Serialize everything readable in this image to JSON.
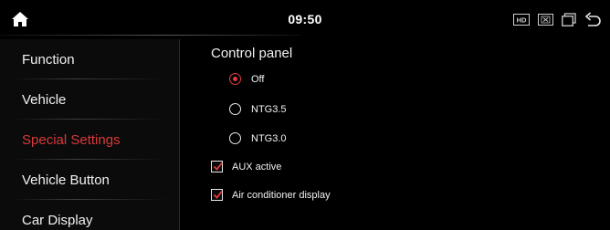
{
  "status_bar": {
    "time": "09:50",
    "icons": [
      "home-icon",
      "hd-icon",
      "close-box-icon",
      "window-icon",
      "back-icon"
    ],
    "hd_label": "HD"
  },
  "sidebar": {
    "items": [
      {
        "label": "Function",
        "active": false
      },
      {
        "label": "Vehicle",
        "active": false
      },
      {
        "label": "Special Settings",
        "active": true
      },
      {
        "label": "Vehicle Button",
        "active": false
      },
      {
        "label": "Car Display",
        "active": false
      }
    ]
  },
  "content": {
    "section_title": "Control panel",
    "options": [
      {
        "label": "Off",
        "selected": true
      },
      {
        "label": "NTG3.5",
        "selected": false
      },
      {
        "label": "NTG3.0",
        "selected": false
      }
    ],
    "checkboxes": [
      {
        "label": "AUX active",
        "checked": true
      },
      {
        "label": "Air conditioner display",
        "checked": true
      }
    ]
  },
  "colors": {
    "accent": "#e03c3c",
    "background": "#000000",
    "sidebar_bg": "#0b0b0b",
    "text": "#f2f2f2"
  }
}
